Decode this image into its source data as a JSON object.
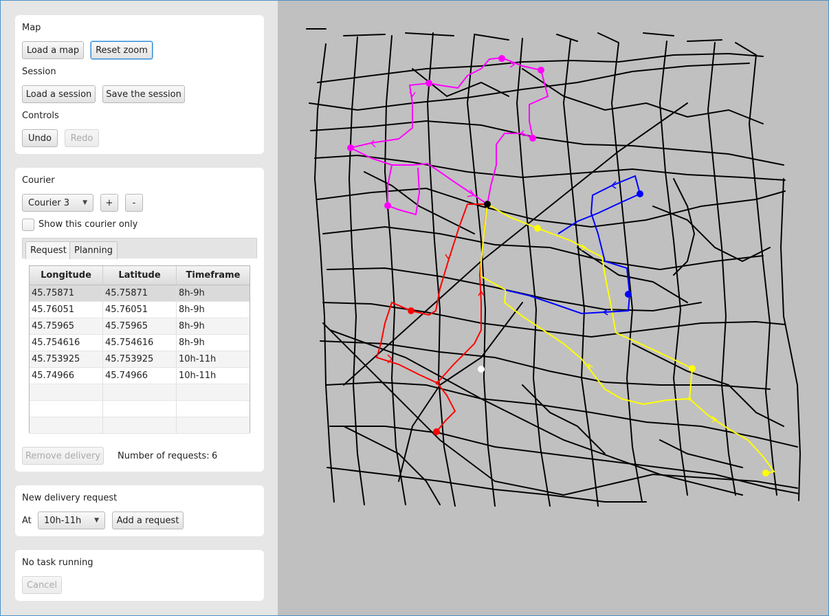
{
  "map_section": {
    "title": "Map",
    "load_label": "Load a map",
    "reset_label": "Reset zoom"
  },
  "session_section": {
    "title": "Session",
    "load_label": "Load a session",
    "save_label": "Save the session"
  },
  "controls_section": {
    "title": "Controls",
    "undo_label": "Undo",
    "redo_label": "Redo"
  },
  "courier_section": {
    "title": "Courier",
    "selected": "Courier 3",
    "add_label": "+",
    "remove_label": "-",
    "show_only_label": "Show this courier only",
    "show_only_checked": false,
    "tabs": [
      "Request",
      "Planning"
    ],
    "active_tab": "Request",
    "columns": [
      "Longitude",
      "Latitude",
      "Timeframe"
    ],
    "rows": [
      [
        "45.75871",
        "45.75871",
        "8h-9h"
      ],
      [
        "45.76051",
        "45.76051",
        "8h-9h"
      ],
      [
        "45.75965",
        "45.75965",
        "8h-9h"
      ],
      [
        "45.754616",
        "45.754616",
        "8h-9h"
      ],
      [
        "45.753925",
        "45.753925",
        "10h-11h"
      ],
      [
        "45.74966",
        "45.74966",
        "10h-11h"
      ],
      [
        "",
        "",
        ""
      ],
      [
        "",
        "",
        ""
      ],
      [
        "",
        "",
        ""
      ]
    ],
    "remove_delivery_label": "Remove delivery",
    "count_label": "Number of requests:",
    "count": "6"
  },
  "new_request_section": {
    "title": "New delivery request",
    "at_label": "At",
    "timeframe": "10h-11h",
    "add_label": "Add a request"
  },
  "task_section": {
    "status": "No task running",
    "cancel_label": "Cancel"
  },
  "map_view": {
    "background": "#c0c0c0",
    "road_color": "#000000",
    "routes": [
      {
        "color": "#ff00ff",
        "stops": 6
      },
      {
        "color": "#ff0000",
        "stops": 3
      },
      {
        "color": "#ffff00",
        "stops": 4
      },
      {
        "color": "#0000ff",
        "stops": 2
      }
    ],
    "warehouse_color": "#000000"
  }
}
